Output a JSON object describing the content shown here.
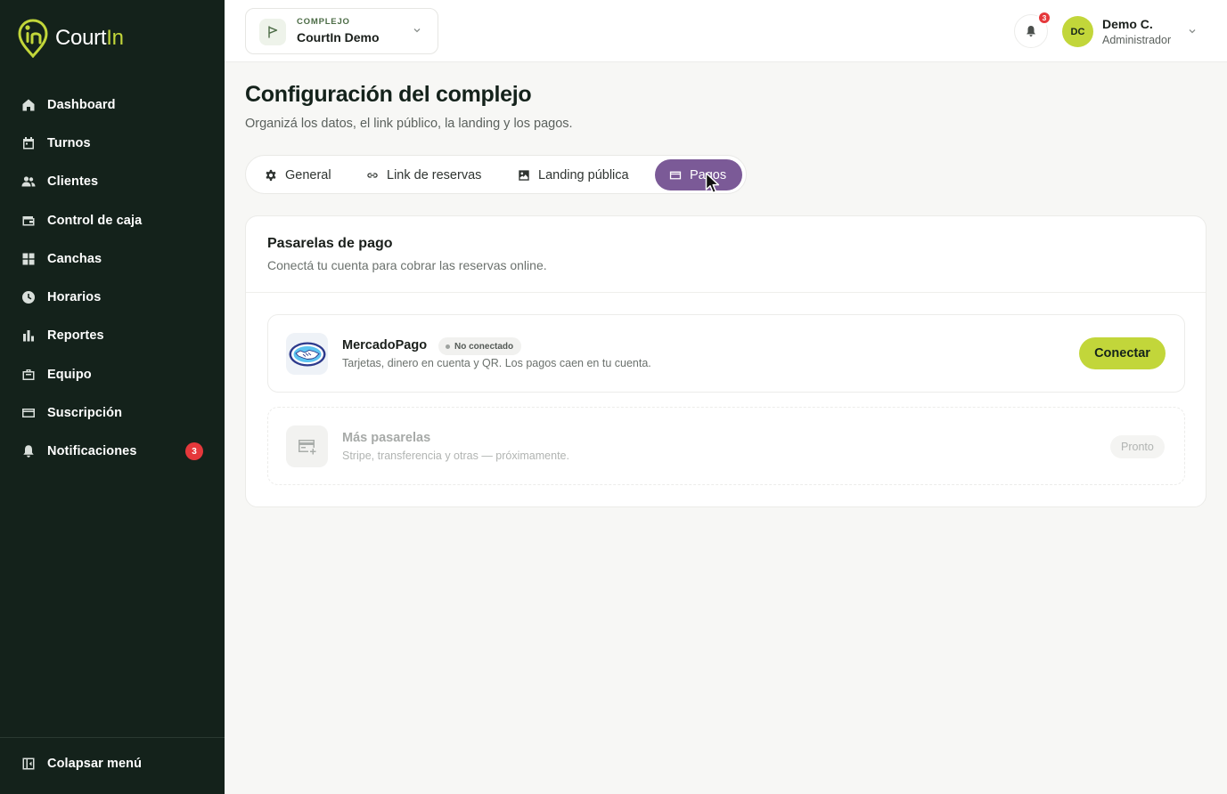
{
  "brand": {
    "name_part1": "Court",
    "name_part2": "In",
    "colors": {
      "sidebar": "#14221b",
      "accent": "#c2d63a",
      "tab_active": "#7b5a97",
      "badge": "#e5383b"
    }
  },
  "sidebar": {
    "items": [
      {
        "label": "Dashboard",
        "icon": "home-icon"
      },
      {
        "label": "Turnos",
        "icon": "calendar-icon"
      },
      {
        "label": "Clientes",
        "icon": "users-icon"
      },
      {
        "label": "Control de caja",
        "icon": "wallet-icon"
      },
      {
        "label": "Canchas",
        "icon": "grid-icon"
      },
      {
        "label": "Horarios",
        "icon": "clock-icon"
      },
      {
        "label": "Reportes",
        "icon": "bar-chart-icon"
      },
      {
        "label": "Equipo",
        "icon": "briefcase-icon"
      },
      {
        "label": "Suscripción",
        "icon": "credit-card-icon"
      },
      {
        "label": "Notificaciones",
        "icon": "bell-icon",
        "badge": "3"
      }
    ],
    "collapse_label": "Colapsar menú"
  },
  "header": {
    "complex_kicker": "COMPLEJO",
    "complex_name": "CourtIn Demo",
    "notifications_count": "3",
    "user": {
      "initials": "DC",
      "name": "Demo C.",
      "role": "Administrador"
    }
  },
  "main": {
    "title": "Configuración del complejo",
    "subtitle": "Organizá los datos, el link público, la landing y los pagos.",
    "tabs": [
      {
        "label": "General",
        "icon": "gear-icon"
      },
      {
        "label": "Link de reservas",
        "icon": "link-icon"
      },
      {
        "label": "Landing pública",
        "icon": "image-icon"
      },
      {
        "label": "Pagos",
        "icon": "credit-card-icon",
        "active": true
      }
    ],
    "card": {
      "title": "Pasarelas de pago",
      "subtitle": "Conectá tu cuenta para cobrar las reservas online.",
      "gateways": [
        {
          "name": "MercadoPago",
          "status": "No conectado",
          "description": "Tarjetas, dinero en cuenta y QR. Los pagos caen en tu cuenta.",
          "action": "Conectar"
        },
        {
          "name": "Más pasarelas",
          "description": "Stripe, transferencia y otras — próximamente.",
          "action": "Pronto"
        }
      ]
    }
  }
}
